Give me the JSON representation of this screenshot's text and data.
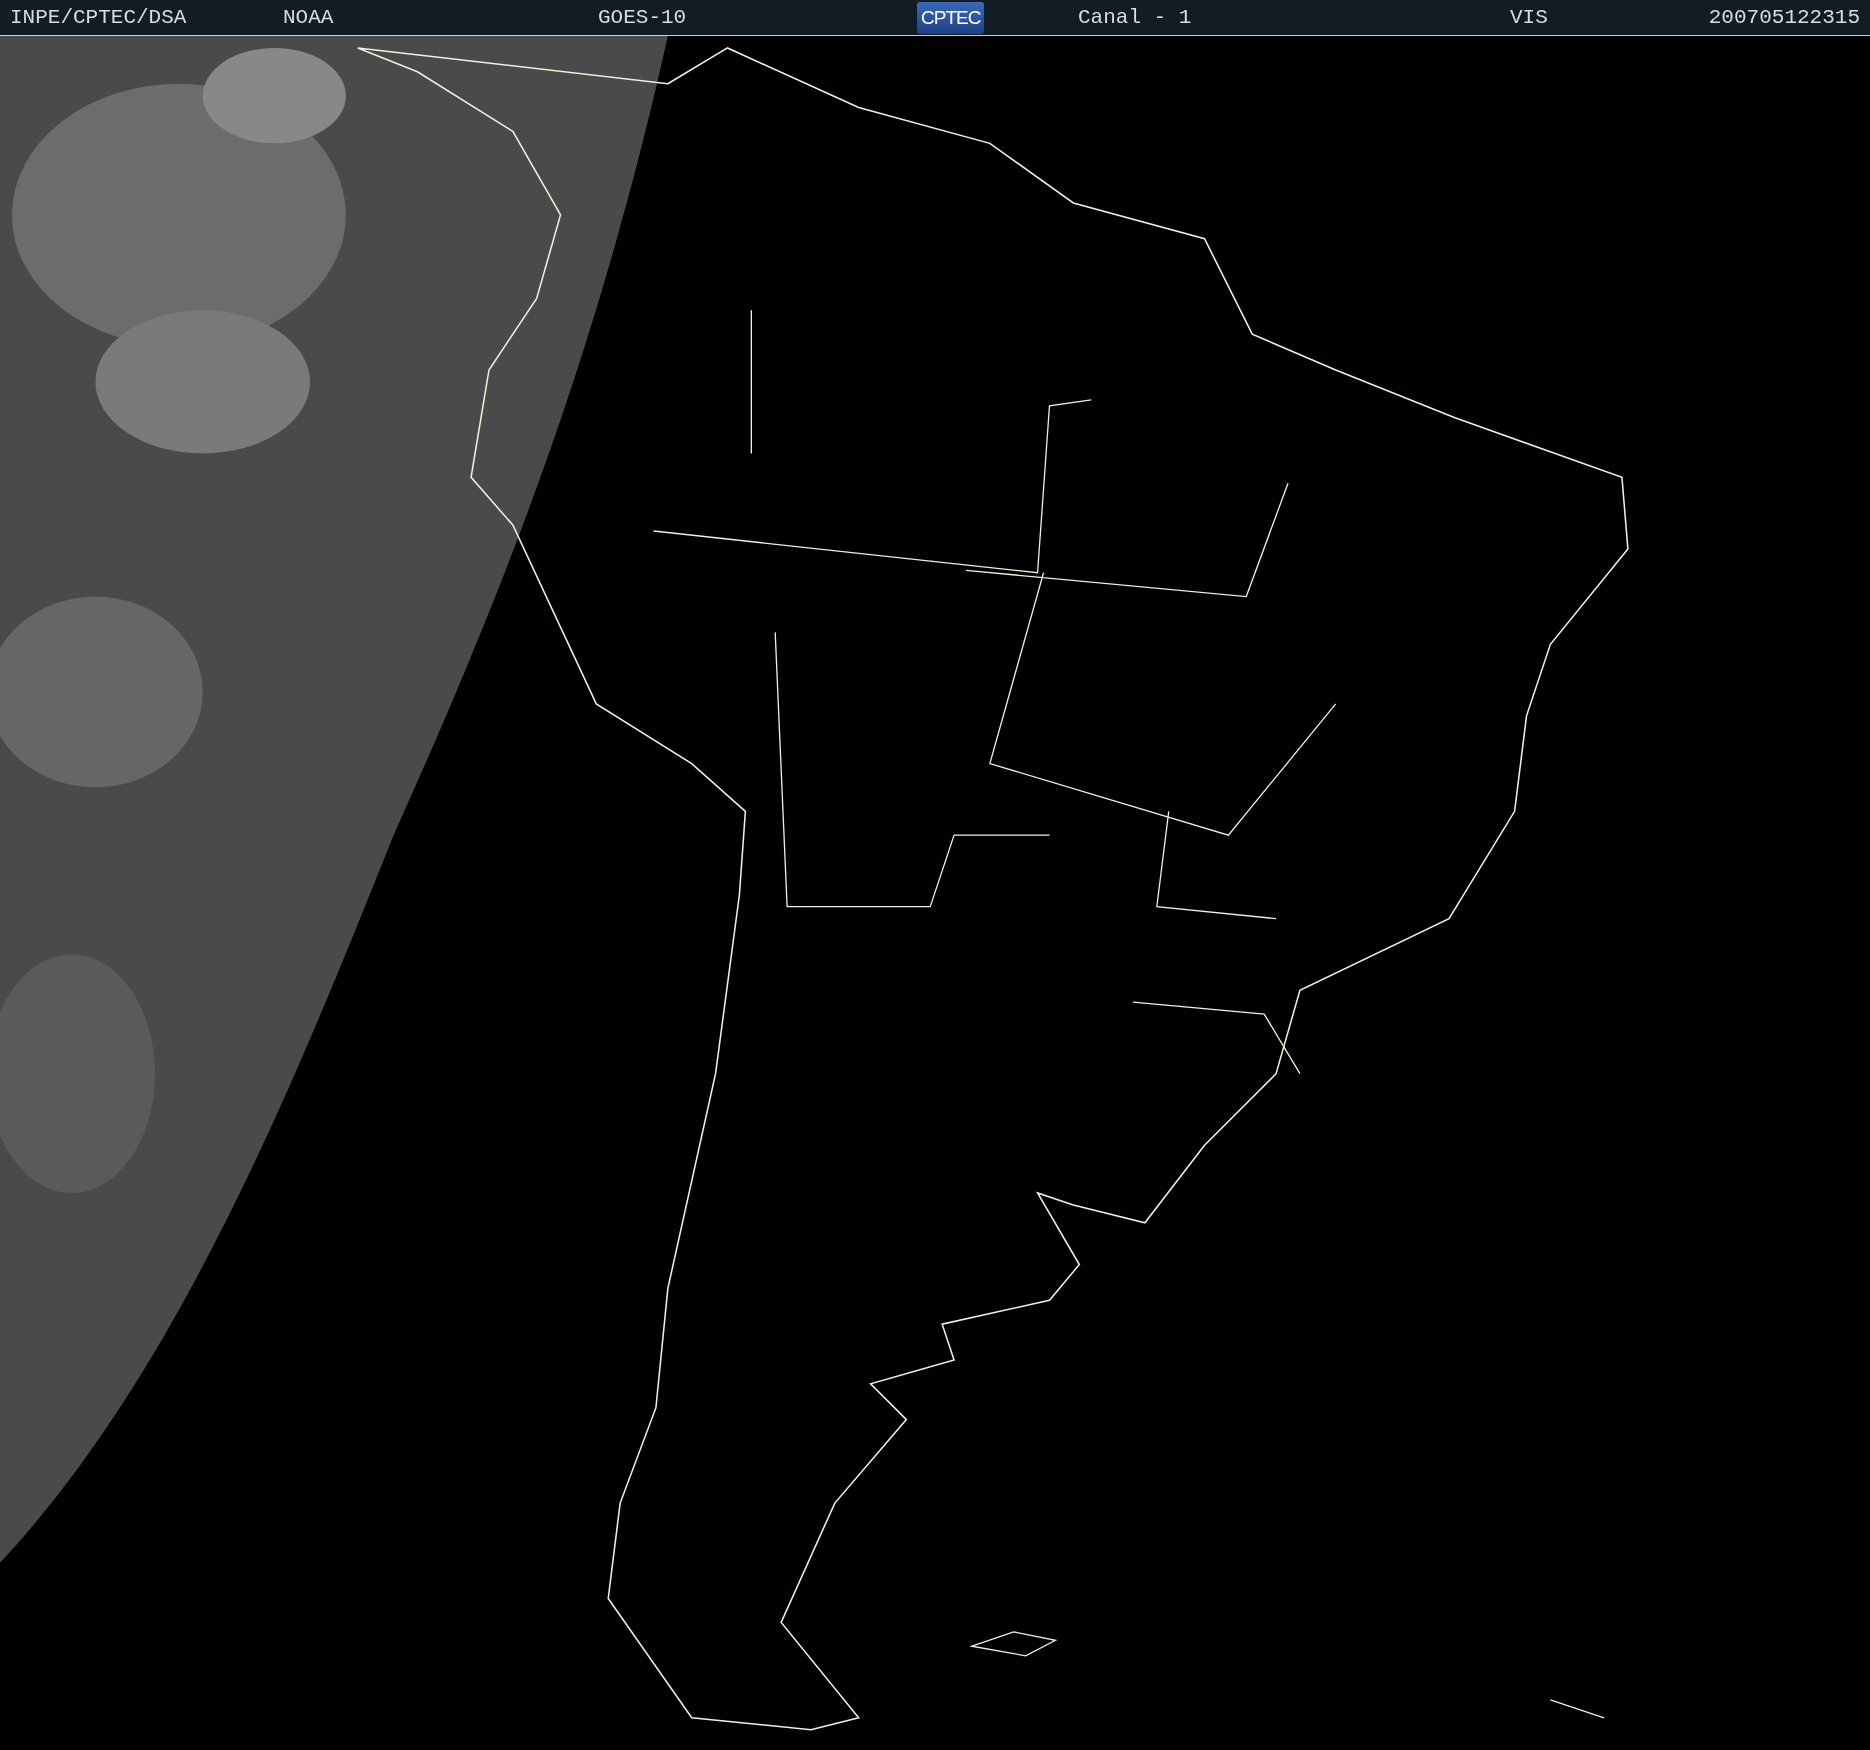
{
  "header": {
    "source": "INPE/CPTEC/DSA",
    "agency": "NOAA",
    "satellite": "GOES-10",
    "logo": "CPTEC",
    "channel": "Canal - 1",
    "band": "VIS",
    "timestamp": "200705122315"
  }
}
